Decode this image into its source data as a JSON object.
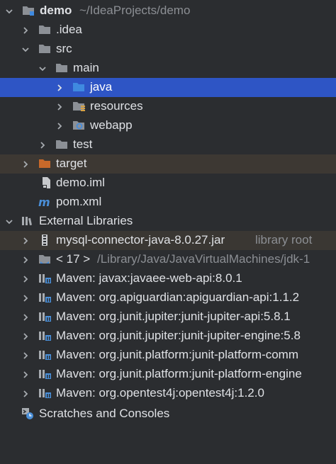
{
  "tree": {
    "root": {
      "label": "demo",
      "path": "~/IdeaProjects/demo"
    },
    "idea": "idea_label",
    "labels": {
      "idea": ".idea",
      "src": "src",
      "main": "main",
      "java": "java",
      "resources": "resources",
      "webapp": "webapp",
      "test": "test",
      "target": "target",
      "demo_iml": "demo.iml",
      "pom_xml": "pom.xml",
      "external_libraries": "External Libraries",
      "mysql_jar": "mysql-connector-java-8.0.27.jar",
      "mysql_hint": "library root",
      "jdk": "< 17 >",
      "jdk_path": "/Library/Java/JavaVirtualMachines/jdk-1",
      "maven1": "Maven: javax:javaee-web-api:8.0.1",
      "maven2": "Maven: org.apiguardian:apiguardian-api:1.1.2",
      "maven3": "Maven: org.junit.jupiter:junit-jupiter-api:5.8.1",
      "maven4": "Maven: org.junit.jupiter:junit-jupiter-engine:5.8",
      "maven5": "Maven: org.junit.platform:junit-platform-comm",
      "maven6": "Maven: org.junit.platform:junit-platform-engine",
      "maven7": "Maven: org.opentest4j:opentest4j:1.2.0",
      "scratches": "Scratches and Consoles"
    }
  },
  "colors": {
    "selection": "#2e55c5",
    "folder": "#8c9096",
    "folder_blue": "#3f8ae0",
    "folder_orange": "#c8692a",
    "maven": "#4a8fd8"
  }
}
